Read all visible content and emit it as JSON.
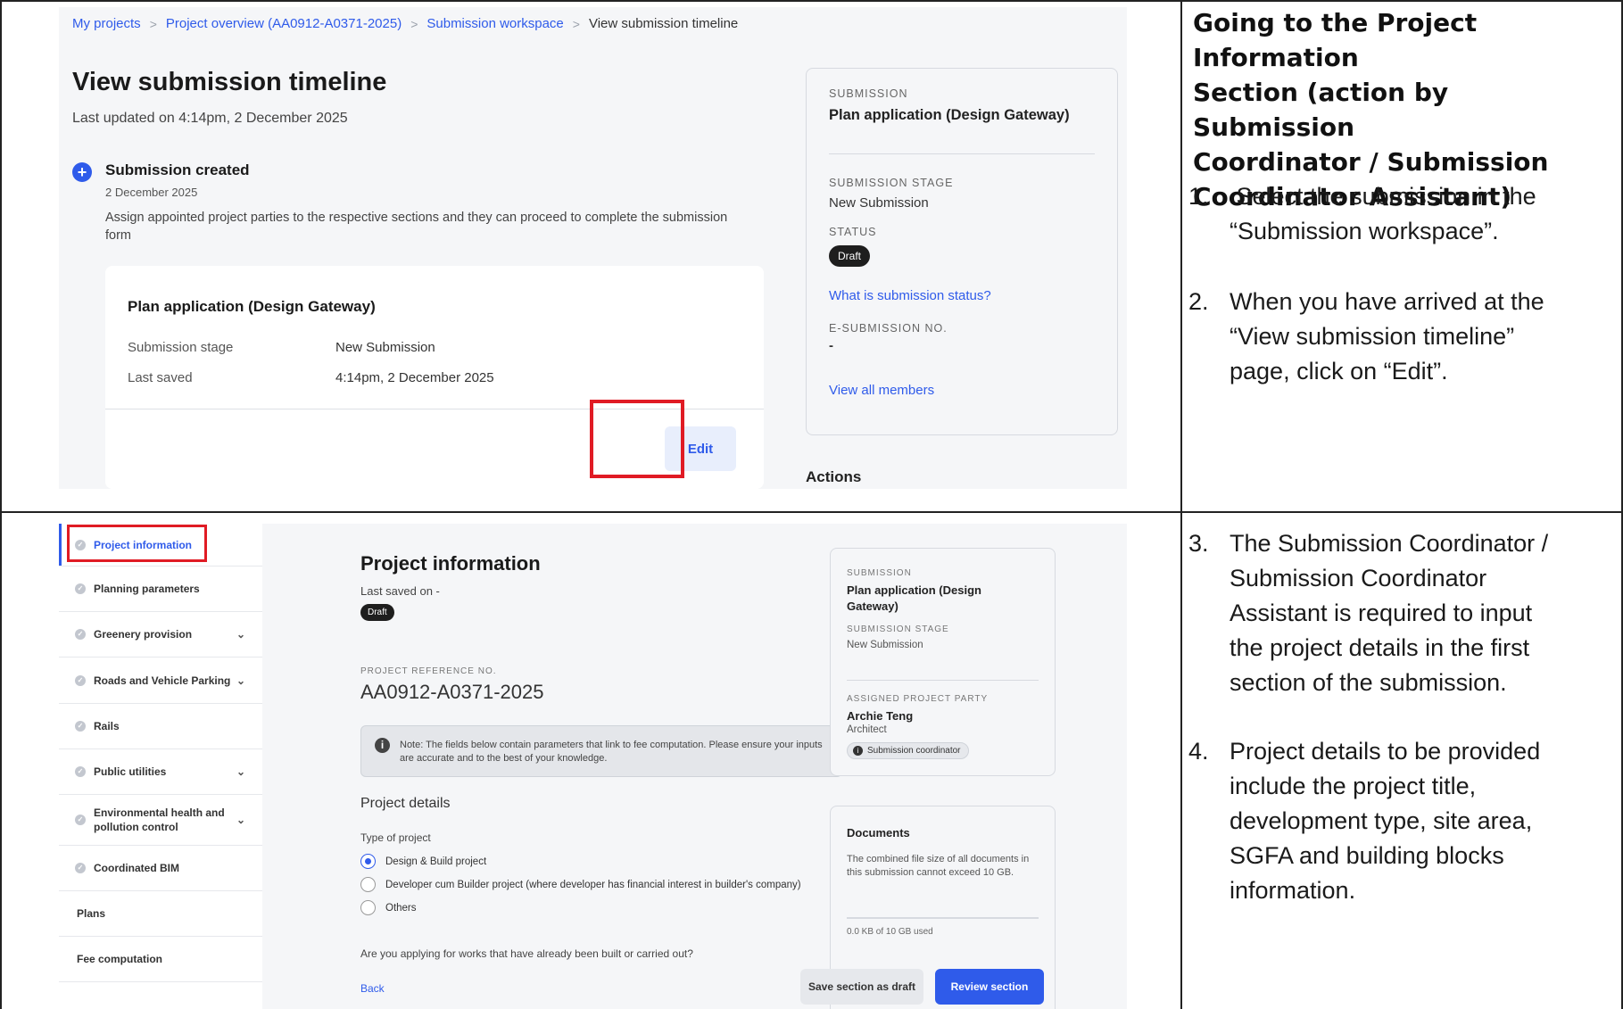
{
  "row1": {
    "heading": "Going to the Project Information Section (action by Submission Coordinator / Submission Coordinator Assistant)",
    "heading_lines": [
      "Going to the Project Information",
      "Section (action by Submission",
      "Coordinator / Submission",
      "Coordinator Assistant)"
    ],
    "steps": [
      {
        "num": "1.",
        "lines": [
          " Select the submission in the",
          "“Submission workspace”."
        ]
      },
      {
        "num": "2.",
        "lines": [
          "When you have arrived at the",
          "“View submission timeline”",
          "page, click on “Edit”."
        ]
      }
    ]
  },
  "row2": {
    "steps": [
      {
        "num": "3.",
        "lines": [
          "The Submission Coordinator /",
          "Submission Coordinator",
          "Assistant is required to input",
          "the project details in the first",
          "section of the submission."
        ]
      },
      {
        "num": "4.",
        "lines": [
          "Project details to be provided",
          "include the project title,",
          "development type, site area,",
          "SGFA and building blocks",
          "information."
        ]
      }
    ]
  },
  "timeline_screen": {
    "breadcrumb": [
      "My projects",
      "Project overview (AA0912-A0371-2025)",
      "Submission workspace",
      "View submission timeline"
    ],
    "title": "View submission timeline",
    "last_updated": "Last updated on 4:14pm, 2 December 2025",
    "event": {
      "title": "Submission created",
      "date": "2 December 2025",
      "description": "Assign appointed project parties to the respective sections and they can proceed to complete the submission form"
    },
    "card": {
      "name": "Plan application (Design Gateway)",
      "stage_label": "Submission stage",
      "stage_value": "New Submission",
      "saved_label": "Last saved",
      "saved_value": "4:14pm, 2 December 2025",
      "edit_label": "Edit"
    },
    "info": {
      "submission_label": "SUBMISSION",
      "submission_value": "Plan application (Design Gateway)",
      "stage_label": "SUBMISSION STAGE",
      "stage_value": "New Submission",
      "status_label": "STATUS",
      "status_value": "Draft",
      "status_link": "What is submission status?",
      "esub_label": "E-SUBMISSION NO.",
      "esub_value": "-",
      "members_link": "View all members"
    },
    "actions_heading": "Actions"
  },
  "project_screen": {
    "sidebar": [
      {
        "label": "Project information",
        "chevron": false
      },
      {
        "label": "Planning parameters",
        "chevron": false
      },
      {
        "label": "Greenery provision",
        "chevron": true
      },
      {
        "label": "Roads and Vehicle Parking",
        "chevron": true
      },
      {
        "label": "Rails",
        "chevron": false
      },
      {
        "label": "Public utilities",
        "chevron": true
      },
      {
        "label": "Environmental health and pollution control",
        "chevron": true
      },
      {
        "label": "Coordinated BIM",
        "chevron": false
      },
      {
        "label": "Plans",
        "chevron": false
      },
      {
        "label": "Fee computation",
        "chevron": false
      }
    ],
    "title": "Project information",
    "last_saved": "Last saved on -",
    "draft": "Draft",
    "ref_label": "PROJECT REFERENCE NO.",
    "ref_value": "AA0912-A0371-2025",
    "note": "Note: The fields below contain parameters that link to fee computation. Please ensure your inputs are accurate and to the best of your knowledge.",
    "details_title": "Project details",
    "type_label": "Type of project",
    "options": [
      {
        "label": "Design & Build project",
        "selected": true
      },
      {
        "label": "Developer cum Builder project (where developer has financial interest in builder's company)",
        "selected": false
      },
      {
        "label": "Others",
        "selected": false
      }
    ],
    "works_question": "Are you applying for works that have already been built or carried out?",
    "back_label": "Back",
    "save_draft_label": "Save section as draft",
    "review_label": "Review section",
    "info": {
      "submission_label": "SUBMISSION",
      "submission_value": "Plan application (Design Gateway)",
      "stage_label": "SUBMISSION STAGE",
      "stage_value": "New Submission",
      "party_label": "ASSIGNED PROJECT PARTY",
      "party_name": "Archie Teng",
      "party_role": "Architect",
      "party_badge": "Submission coordinator"
    },
    "documents": {
      "title": "Documents",
      "description": "The combined file size of all documents in this submission cannot exceed 10 GB.",
      "usage": "0.0 KB of 10 GB used",
      "usage_fraction": 0
    }
  },
  "colors": {
    "accent": "#2f5bea",
    "highlight": "#e01b24",
    "badge": "#1e1e1e"
  }
}
